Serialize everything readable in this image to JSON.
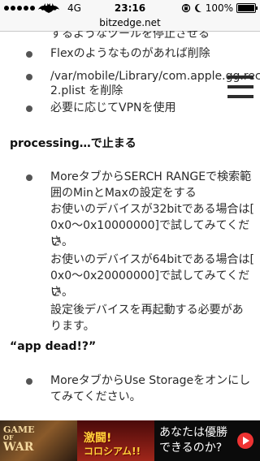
{
  "status_bar": {
    "network": "4G",
    "time": "23:16",
    "battery": "100%"
  },
  "url_bar": {
    "domain": "bitzedge.net"
  },
  "content": {
    "partial_line": "するようなツールを停止させる",
    "top_list": [
      "Flexのようなものがあれば削除",
      "/var/mobile/Library/com.apple.gg.record",
      "2.plist を削除",
      "必要に応じてVPNを使用"
    ],
    "section1": {
      "heading": "processing…で止まる",
      "lines": [
        "MoreタブからSERCH RANGEで検索範",
        "囲のMinとMaxの設定をする",
        "お使いのデバイスが32bitである場合は[",
        "0x0～0x10000000]で試してみてくださ",
        "い。",
        "お使いのデバイスが64bitである場合は[",
        "0x0～0x20000000]で試してみてくださ",
        "い。",
        "設定後デバイスを再起動する必要があ",
        "ります。"
      ]
    },
    "section2": {
      "heading": "“app dead!?”",
      "lines": [
        "MoreタブからUse Storageをオンにし",
        "てみてください。"
      ]
    }
  },
  "ad": {
    "game_title_1": "GAME",
    "game_title_2": "OF",
    "game_title_3": "WAR",
    "mid_text_1": "激闘!",
    "mid_text_2": "コロシアム!!",
    "right_text_1": "あなたは優勝",
    "right_text_2": "できるのか?"
  }
}
